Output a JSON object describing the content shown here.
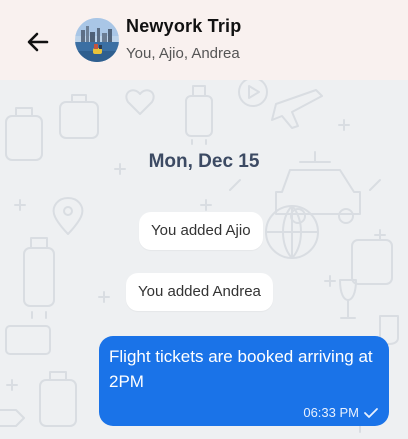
{
  "header": {
    "title": "Newyork Trip",
    "members": "You, Ajio, Andrea"
  },
  "chat": {
    "date_separator": "Mon, Dec 15",
    "system_messages": [
      "You added Ajio",
      "You added Andrea"
    ],
    "messages": [
      {
        "text": "Flight tickets are booked arriving at 2PM",
        "time": "06:33 PM",
        "status_icon": "check-icon"
      }
    ]
  },
  "colors": {
    "header_bg": "#f9f1ef",
    "chat_bg": "#eef0f2",
    "outgoing_bubble": "#1a73e8",
    "date_text": "#3c4a63"
  }
}
